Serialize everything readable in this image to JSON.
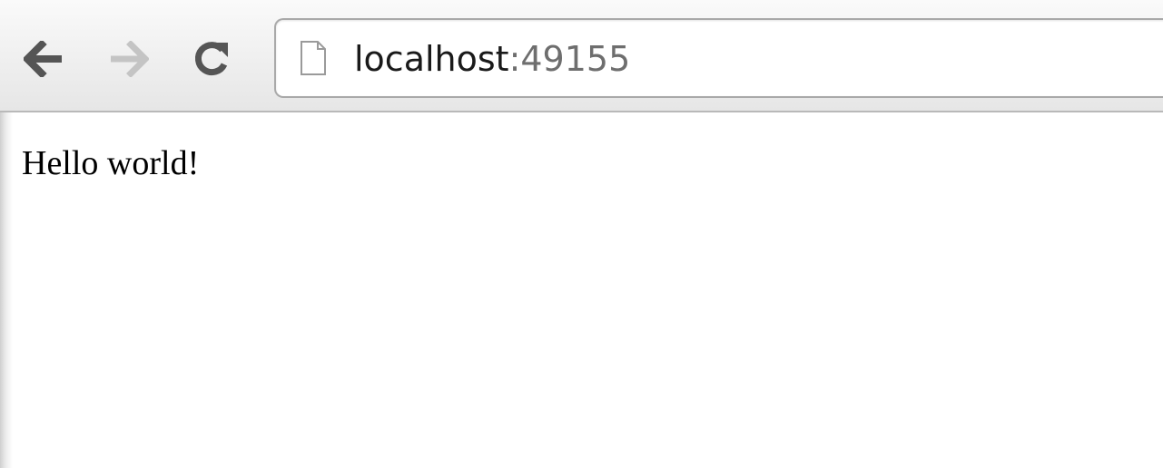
{
  "toolbar": {
    "back_icon": "arrow-left-icon",
    "forward_icon": "arrow-right-icon",
    "reload_icon": "reload-icon",
    "forward_enabled": false
  },
  "omnibox": {
    "page_icon": "blank-page-icon",
    "host": "localhost",
    "port_suffix": ":49155"
  },
  "page": {
    "body_text": "Hello world!"
  },
  "colors": {
    "toolbar_bg": "#f1f1f1",
    "icon_active": "#555555",
    "icon_disabled": "#c4c4c4",
    "port_text": "#6e6e6e"
  }
}
